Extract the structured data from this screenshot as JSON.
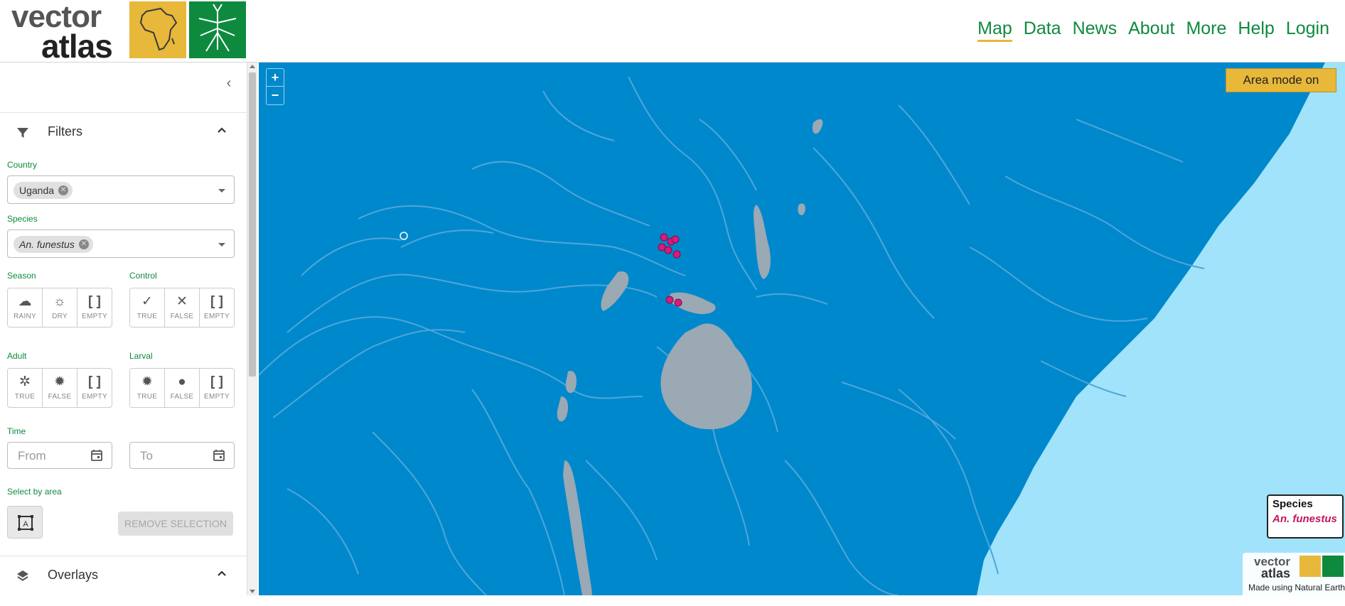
{
  "header": {
    "logo": {
      "line1": "vector",
      "line2": "atlas"
    },
    "nav": [
      {
        "label": "Map",
        "active": true
      },
      {
        "label": "Data",
        "active": false
      },
      {
        "label": "News",
        "active": false
      },
      {
        "label": "About",
        "active": false
      },
      {
        "label": "More",
        "active": false
      },
      {
        "label": "Help",
        "active": false
      },
      {
        "label": "Login",
        "active": false
      }
    ]
  },
  "sidebar": {
    "filters": {
      "title": "Filters",
      "country": {
        "label": "Country",
        "selected": "Uganda"
      },
      "species": {
        "label": "Species",
        "selected": "An. funestus"
      },
      "season": {
        "label": "Season",
        "options": [
          "RAINY",
          "DRY",
          "EMPTY"
        ]
      },
      "control": {
        "label": "Control",
        "options": [
          "TRUE",
          "FALSE",
          "EMPTY"
        ]
      },
      "adult": {
        "label": "Adult",
        "options": [
          "TRUE",
          "FALSE",
          "EMPTY"
        ]
      },
      "larval": {
        "label": "Larval",
        "options": [
          "TRUE",
          "FALSE",
          "EMPTY"
        ]
      },
      "time": {
        "label": "Time",
        "from_placeholder": "From",
        "to_placeholder": "To"
      },
      "area": {
        "label": "Select by area",
        "remove_label": "REMOVE SELECTION"
      }
    },
    "overlays": {
      "title": "Overlays"
    }
  },
  "map": {
    "zoom_in": "+",
    "zoom_out": "−",
    "area_mode_label": "Area mode on",
    "legend": {
      "title": "Species",
      "item": "An. funestus"
    },
    "attribution": {
      "line1": "vector",
      "line2": "atlas",
      "text": "Made using Natural Earth"
    },
    "colors": {
      "land": "#0088cc",
      "ocean": "#a1e3fa",
      "lake": "#9aa9b3",
      "river": "#4ea6da",
      "point": "#d81b7c"
    }
  }
}
